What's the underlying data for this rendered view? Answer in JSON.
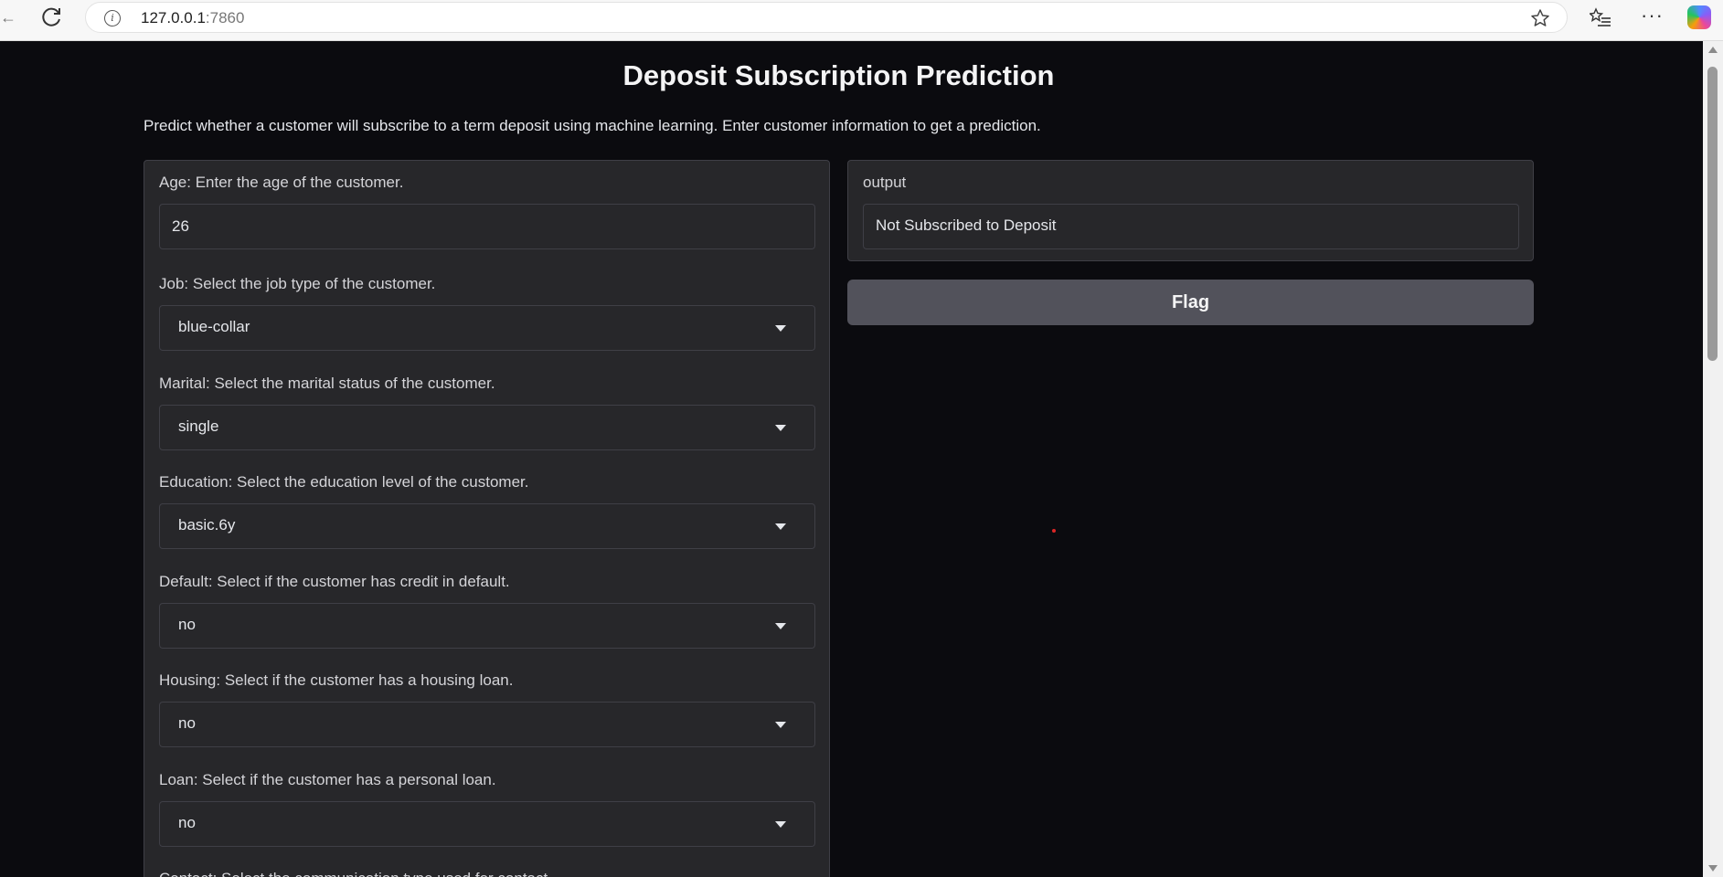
{
  "browser": {
    "url_host": "127.0.0.1",
    "url_port": ":7860"
  },
  "page": {
    "title": "Deposit Subscription Prediction",
    "description": "Predict whether a customer will subscribe to a term deposit using machine learning. Enter customer information to get a prediction."
  },
  "form": {
    "age": {
      "label": "Age: Enter the age of the customer.",
      "value": "26"
    },
    "job": {
      "label": "Job: Select the job type of the customer.",
      "value": "blue-collar"
    },
    "marital": {
      "label": "Marital: Select the marital status of the customer.",
      "value": "single"
    },
    "education": {
      "label": "Education: Select the education level of the customer.",
      "value": "basic.6y"
    },
    "default": {
      "label": "Default: Select if the customer has credit in default.",
      "value": "no"
    },
    "housing": {
      "label": "Housing: Select if the customer has a housing loan.",
      "value": "no"
    },
    "loan": {
      "label": "Loan: Select if the customer has a personal loan.",
      "value": "no"
    },
    "contact": {
      "label": "Contact: Select the communication type used for contact."
    }
  },
  "output": {
    "label": "output",
    "value": "Not Subscribed to Deposit"
  },
  "actions": {
    "flag_label": "Flag"
  },
  "theme": {
    "background": "#0b0b0f",
    "panel": "#27272a",
    "button": "#52525b"
  }
}
